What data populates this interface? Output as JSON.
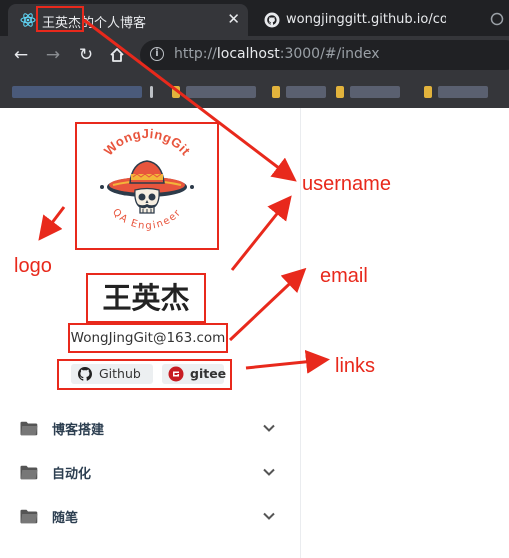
{
  "browser": {
    "tabs": [
      {
        "title": "王英杰的个人博客",
        "active": true
      },
      {
        "title": "wongjinggitt.github.io/configu",
        "active": false
      }
    ],
    "url": {
      "prefix": "http://",
      "host": "localhost",
      "rest": ":3000/#/index"
    }
  },
  "profile": {
    "logo_text": "WongJingGit",
    "logo_subtitle": "QA Engineer",
    "name": "王英杰",
    "email": "WongJingGit@163.com",
    "links": [
      {
        "label": "Github",
        "icon": "github-icon"
      },
      {
        "label": "gitee",
        "icon": "gitee-icon"
      }
    ]
  },
  "menu": [
    {
      "label": "博客搭建",
      "icon": "folder-icon"
    },
    {
      "label": "自动化",
      "icon": "folder-icon"
    },
    {
      "label": "随笔",
      "icon": "folder-icon"
    }
  ],
  "annotations": {
    "logo": "logo",
    "username": "username",
    "email": "email",
    "links": "links"
  },
  "colors": {
    "annotation": "#e8291c",
    "chrome_dark": "#202124",
    "chrome_mid": "#35363a",
    "logo_accent": "#e8553d"
  }
}
